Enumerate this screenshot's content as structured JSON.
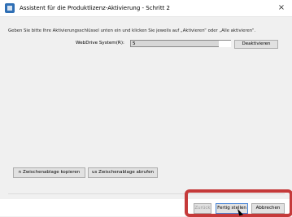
{
  "window": {
    "title": "Assistent für die Produktlizenz-Aktivierung - Schritt 2",
    "close_label": "×"
  },
  "main": {
    "instruction": "Geben Sie bitte Ihre Aktivierungsschlüssel unten ein und klicken Sie jeweils auf „Aktivieren“ oder „Alle aktivieren“.",
    "row_label": "WebDrive System(R):",
    "key_value": "5",
    "deactivate_label": "Deaktivieren",
    "copy_label": "n Zwischenablage kopieren",
    "paste_label": "us Zwischenablage abrufen"
  },
  "footer": {
    "back_label": "Zurück",
    "finish_label": "Fertig stellen",
    "cancel_label": "Abbrechen"
  }
}
